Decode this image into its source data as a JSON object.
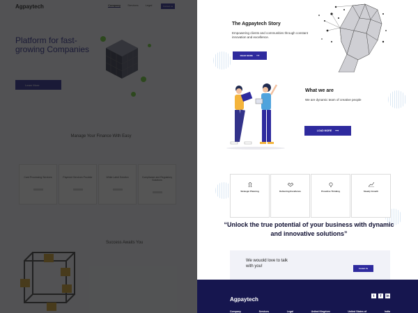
{
  "left": {
    "logo": "Agpaytech",
    "nav": [
      "Company",
      "Services",
      "Legal"
    ],
    "nav_contact": "Contact us",
    "hero": {
      "title": "Platform for fast-growing Companies",
      "button": "Learn More"
    },
    "section2": {
      "title": "Manage Your Finance With Easy"
    },
    "cards": [
      {
        "title": "Card Processing Services"
      },
      {
        "title": "Payment Services Provider"
      },
      {
        "title": "White Label Solution"
      },
      {
        "title": "Compliance and Regulatory Solutions"
      }
    ],
    "section3": {
      "title": "Success Awaits You"
    }
  },
  "story": {
    "title": "The Agpaytech Story",
    "lead": "Empowering clients and communities through constant innovation and excellence.",
    "button": "READ MORE"
  },
  "what_we_are": {
    "title": "What we are",
    "lead": "We are dynamic team of creative people",
    "button": "LOAD MORE"
  },
  "services": [
    {
      "title": "Strategic Planning",
      "icon": "chess-icon"
    },
    {
      "title": "Delivering Excellence",
      "icon": "handshake-icon"
    },
    {
      "title": "Proactive Thinking",
      "icon": "bulb-icon"
    },
    {
      "title": "Steady Growth",
      "icon": "growth-chart-icon"
    }
  ],
  "quote": "“Unlock the true potential of your business with dynamic and innovative solutions”",
  "talk": {
    "title": "We wouold love to talk with you!",
    "button": "Contact Us"
  },
  "footer": {
    "logo": "Agpaytech",
    "social": [
      "twitter-icon",
      "facebook-icon",
      "linkedin-icon"
    ],
    "columns": [
      "Company",
      "Services",
      "Legal",
      "United Kingdom",
      "United States of",
      "India"
    ]
  },
  "colors": {
    "primary": "#2e2a9e",
    "footer_bg": "#16164f",
    "accent_green": "#6fcf3a",
    "hero_title": "#2d2d8f"
  }
}
